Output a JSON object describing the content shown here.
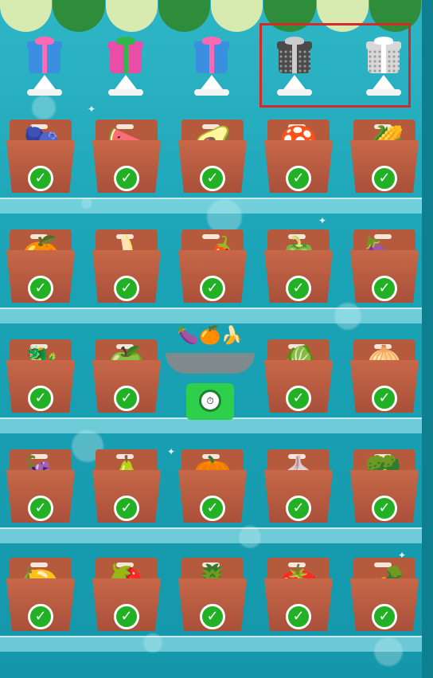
{
  "colors": {
    "check_green": "#22b024",
    "highlight_red": "#d42a2a",
    "crate": "#b55a3c",
    "background_teal": "#1aa3b6"
  },
  "gifts": [
    {
      "name": "gift-blue-pink",
      "locked": false,
      "box": "#3a8fe0",
      "ribbon": "#ff69b4"
    },
    {
      "name": "gift-pink-green",
      "locked": false,
      "box": "#e84ea8",
      "ribbon": "#2fb84a"
    },
    {
      "name": "gift-blue-pink-2",
      "locked": false,
      "box": "#3a8fe0",
      "ribbon": "#ff69b4"
    },
    {
      "name": "gift-dark-locked",
      "locked": true,
      "box": "#4a4a4a",
      "ribbon": "#cccccc"
    },
    {
      "name": "gift-silver-locked",
      "locked": true,
      "box": "#d8d8d8",
      "ribbon": "#ffffff"
    }
  ],
  "crates": [
    {
      "id": "blackberries",
      "icon": "🫐",
      "completed": true
    },
    {
      "id": "watermelon",
      "icon": "🍉",
      "completed": true
    },
    {
      "id": "avocado",
      "icon": "🥑",
      "completed": true
    },
    {
      "id": "mushroom",
      "icon": "🍄",
      "completed": true
    },
    {
      "id": "corn",
      "icon": "🌽",
      "completed": true
    },
    {
      "id": "oranges",
      "icon": "🍊",
      "completed": true
    },
    {
      "id": "bananas",
      "icon": "🍌",
      "completed": true
    },
    {
      "id": "chili-pepper",
      "icon": "🌶️",
      "completed": true
    },
    {
      "id": "bell-peppers",
      "icon": "🫑",
      "completed": true
    },
    {
      "id": "eggplant",
      "icon": "🍆",
      "completed": true
    },
    {
      "id": "dragon-fruit",
      "icon": "🐉",
      "completed": true
    },
    {
      "id": "green-apples",
      "icon": "🍏",
      "completed": true
    },
    {
      "id": "scale",
      "icon": "",
      "completed": false
    },
    {
      "id": "cabbage",
      "icon": "🥬",
      "completed": true
    },
    {
      "id": "turnip",
      "icon": "🧅",
      "completed": true
    },
    {
      "id": "grapes",
      "icon": "🍇",
      "completed": true
    },
    {
      "id": "pears",
      "icon": "🍐",
      "completed": true
    },
    {
      "id": "pumpkin",
      "icon": "🎃",
      "completed": true
    },
    {
      "id": "leeks",
      "icon": "🧄",
      "completed": true
    },
    {
      "id": "cauliflower",
      "icon": "🥦",
      "completed": true
    },
    {
      "id": "lemons",
      "icon": "🍋",
      "completed": true
    },
    {
      "id": "strawberries",
      "icon": "🍓",
      "completed": true
    },
    {
      "id": "pineapple",
      "icon": "🍍",
      "completed": true
    },
    {
      "id": "tomatoes",
      "icon": "🍅",
      "completed": true
    },
    {
      "id": "carrot",
      "icon": "🥕",
      "completed": true
    }
  ],
  "scale": {
    "items_icon": "🍆🍊🍌",
    "dial_icon": "⏱"
  },
  "checkmark_glyph": "✓"
}
